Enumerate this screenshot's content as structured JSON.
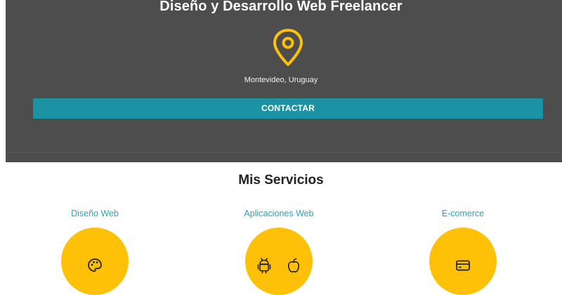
{
  "hero": {
    "title": "Diseño y Desarrollo Web Freelancer",
    "location": "Montevideo, Uruguay",
    "pin_icon": "map-pin-icon",
    "accent_color": "#ffc107",
    "background": "#4d4d4d"
  },
  "contact": {
    "button_label": "CONTACTAR",
    "color": "#1b93a5"
  },
  "services": {
    "title": "Mis Servicios",
    "items": [
      {
        "label": "Diseño Web",
        "icons": [
          "palette-icon"
        ]
      },
      {
        "label": "Aplicaciones Web",
        "icons": [
          "android-icon",
          "apple-icon"
        ]
      },
      {
        "label": "E-comerce",
        "icons": [
          "credit-card-icon"
        ]
      }
    ],
    "label_color": "#2aa3b5",
    "circle_color": "#ffc107"
  }
}
